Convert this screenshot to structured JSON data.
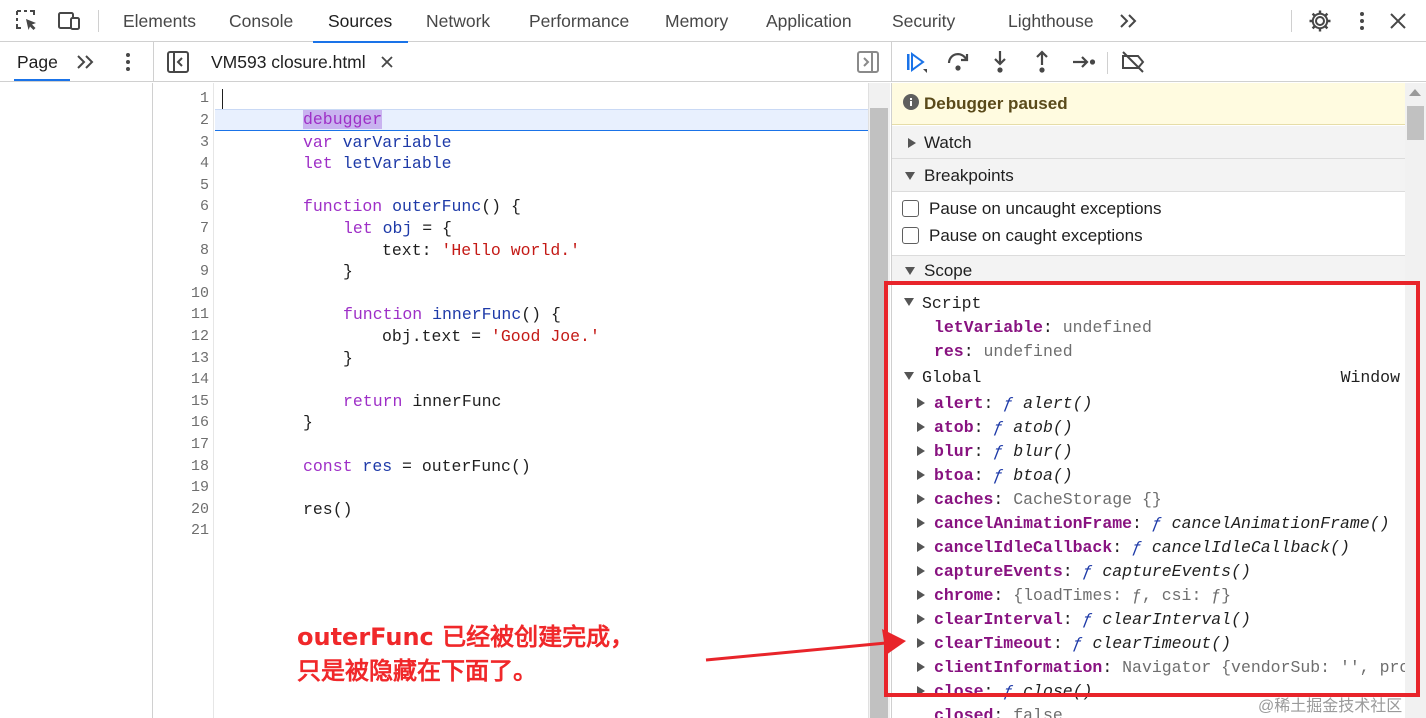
{
  "topbar": {
    "tabs": [
      "Elements",
      "Console",
      "Sources",
      "Network",
      "Performance",
      "Memory",
      "Application",
      "Security",
      "Lighthouse"
    ],
    "active_tab": "Sources"
  },
  "navigator": {
    "tab_label": "Page"
  },
  "editor": {
    "file_tab": "VM593 closure.html",
    "line_numbers": [
      "1",
      "2",
      "3",
      "4",
      "5",
      "6",
      "7",
      "8",
      "9",
      "10",
      "11",
      "12",
      "13",
      "14",
      "15",
      "16",
      "17",
      "18",
      "19",
      "20",
      "21"
    ],
    "paused_line": 2
  },
  "debugger": {
    "paused_label": "Debugger paused",
    "watch_label": "Watch",
    "breakpoints_label": "Breakpoints",
    "pause_uncaught": "Pause on uncaught exceptions",
    "pause_caught": "Pause on caught exceptions",
    "scope_label": "Scope"
  },
  "scope": {
    "script_label": "Script",
    "script_vars": [
      {
        "name": "letVariable",
        "value": "undefined"
      },
      {
        "name": "res",
        "value": "undefined"
      }
    ],
    "global_label": "Global",
    "global_value": "Window",
    "global_items": [
      {
        "name": "alert",
        "value": "alert()"
      },
      {
        "name": "atob",
        "value": "atob()"
      },
      {
        "name": "blur",
        "value": "blur()"
      },
      {
        "name": "btoa",
        "value": "btoa()"
      },
      {
        "name": "caches",
        "value": "CacheStorage {}"
      },
      {
        "name": "cancelAnimationFrame",
        "value": "cancelAnimationFrame()"
      },
      {
        "name": "cancelIdleCallback",
        "value": "cancelIdleCallback()"
      },
      {
        "name": "captureEvents",
        "value": "captureEvents()"
      },
      {
        "name": "chrome",
        "value": "{loadTimes: ƒ, csi: ƒ}"
      },
      {
        "name": "clearInterval",
        "value": "clearInterval()"
      },
      {
        "name": "clearTimeout",
        "value": "clearTimeout()"
      },
      {
        "name": "clientInformation",
        "value": "Navigator {vendorSub: '', pro"
      },
      {
        "name": "close",
        "value": "close()"
      },
      {
        "name": "closed",
        "value": "false"
      }
    ]
  },
  "annotation": {
    "text": "outerFunc 已经被创建完成，\n只是被隐藏在下面了。",
    "color": "#e8242a"
  },
  "watermark": "@稀土掘金技术社区"
}
